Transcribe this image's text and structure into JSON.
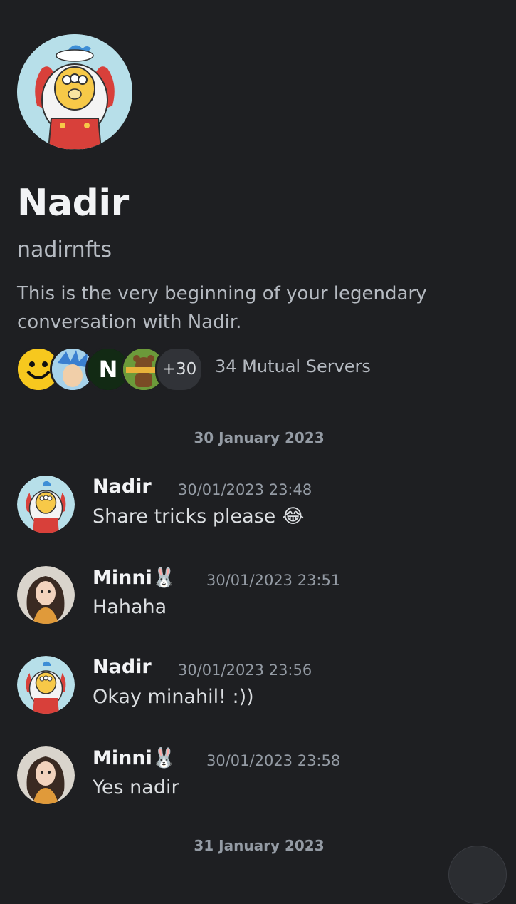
{
  "profile": {
    "display_name": "Nadir",
    "username": "nadirnfts",
    "intro": "This is the very beginning of your legendary conversation with Nadir."
  },
  "mutual": {
    "more_count": "+30",
    "label": "34 Mutual Servers",
    "server_icons": [
      "smiley-server-icon",
      "anime-server-icon",
      "n-server-icon",
      "bear-server-icon"
    ]
  },
  "dividers": [
    "30 January 2023",
    "31 January 2023"
  ],
  "messages": [
    {
      "author": "Nadir",
      "timestamp": "30/01/2023 23:48",
      "text": "Share tricks please 😂"
    },
    {
      "author": "Minni🐰",
      "timestamp": "30/01/2023 23:51",
      "text": "Hahaha"
    },
    {
      "author": "Nadir",
      "timestamp": "30/01/2023 23:56",
      "text": "Okay minahil! :))"
    },
    {
      "author": "Minni🐰",
      "timestamp": "30/01/2023 23:58",
      "text": "Yes nadir"
    }
  ],
  "colors": {
    "background": "#1e1f22",
    "primary_text": "#f2f3f5",
    "muted_text": "#949ba4",
    "avatar_bg": "#b7dfe9"
  }
}
